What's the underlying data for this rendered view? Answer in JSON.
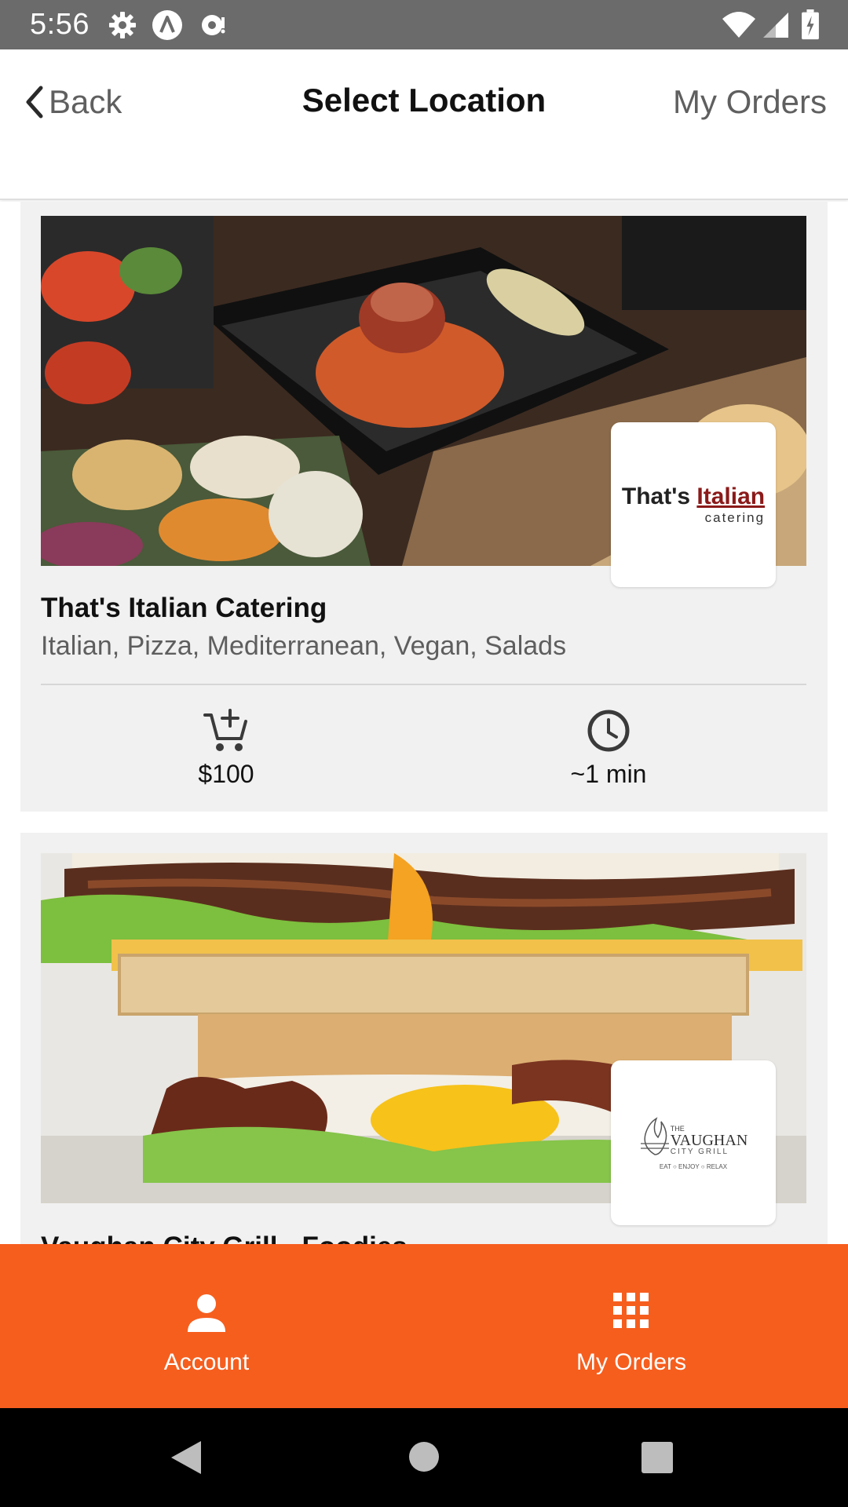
{
  "status_bar": {
    "time": "5:56"
  },
  "header": {
    "back_label": "Back",
    "title": "Select Location",
    "orders_label": "My Orders"
  },
  "restaurants": [
    {
      "name": "That's Italian Catering",
      "cuisines": "Italian, Pizza, Mediterranean, Vegan, Salads",
      "logo_text": "That's",
      "logo_text_accent": "Italian",
      "logo_subtext": "catering",
      "minimum_order": "$100",
      "wait_time": "~1 min"
    },
    {
      "name": "Vaughan City Grill - Foodies",
      "logo_small": "THE",
      "logo_text": "VAUGHAN",
      "logo_subtext": "CITY GRILL",
      "logo_tagline": "EAT  ○  ENJOY  ○  RELAX"
    }
  ],
  "bottom_nav": {
    "account_label": "Account",
    "orders_label": "My Orders"
  },
  "icons": {
    "status": [
      "gear-icon",
      "a-circle-icon",
      "cast-icon",
      "wifi-icon",
      "signal-icon",
      "battery-icon"
    ],
    "back": "chevron-left-icon",
    "min_order": "cart-plus-icon",
    "time": "clock-icon",
    "account": "person-icon",
    "orders": "grid-icon",
    "system": [
      "nav-back-icon",
      "nav-home-icon",
      "nav-recents-icon"
    ]
  },
  "colors": {
    "accent": "#f65e1e",
    "status_bar": "#6b6b6b",
    "card_bg": "#f1f1f1",
    "logo_red": "#8b1a1a"
  }
}
